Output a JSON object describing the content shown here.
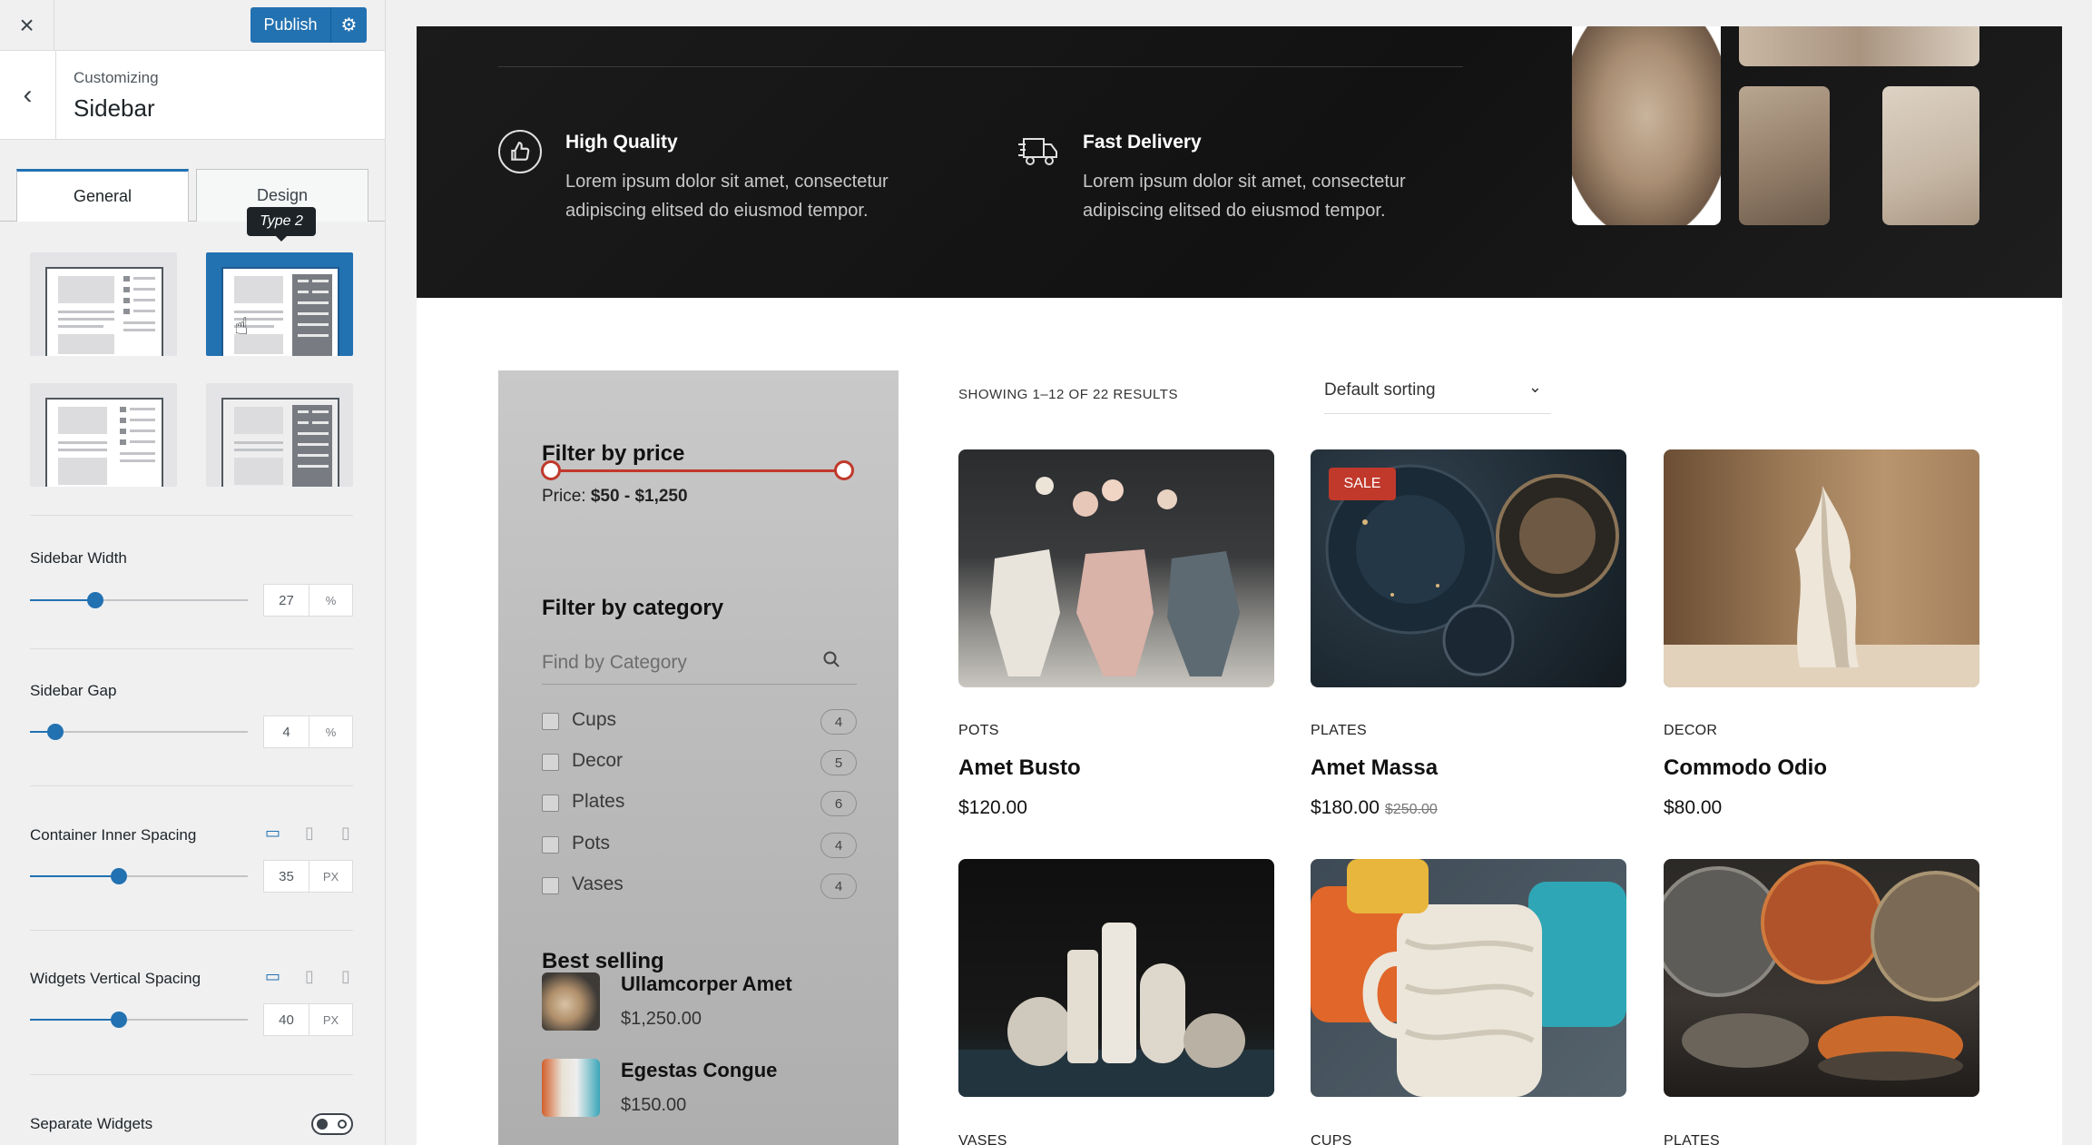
{
  "customizer": {
    "close_icon": "×",
    "publish_label": "Publish",
    "gear_icon": "⚙",
    "back_icon": "‹",
    "subtitle": "Customizing",
    "title": "Sidebar",
    "tabs": [
      {
        "label": "General"
      },
      {
        "label": "Design"
      }
    ],
    "tooltip": "Type 2",
    "layout_options": [
      "type-1",
      "type-2",
      "type-3",
      "type-4"
    ],
    "selected_layout": "type-2",
    "settings": {
      "sidebar_width": {
        "label": "Sidebar Width",
        "value": "27",
        "unit": "%",
        "fraction": 0.27
      },
      "sidebar_gap": {
        "label": "Sidebar Gap",
        "value": "4",
        "unit": "%",
        "fraction": 0.04
      },
      "container_inner_spacing": {
        "label": "Container Inner Spacing",
        "value": "35",
        "unit": "PX",
        "fraction": 0.35
      },
      "widgets_vertical_spacing": {
        "label": "Widgets Vertical Spacing",
        "value": "40",
        "unit": "PX",
        "fraction": 0.35
      },
      "separate_widgets": {
        "label": "Separate Widgets",
        "enabled": false
      }
    }
  },
  "preview": {
    "features": [
      {
        "icon": "thumbs-up-icon",
        "title": "High Quality",
        "text": "Lorem ipsum dolor sit amet, consectetur adipiscing elitsed do eiusmod tempor."
      },
      {
        "icon": "delivery-truck-icon",
        "title": "Fast Delivery",
        "text": "Lorem ipsum dolor sit amet, consectetur adipiscing elitsed do eiusmod tempor."
      }
    ],
    "sidebar": {
      "filter_price_title": "Filter by price",
      "price_prefix": "Price:",
      "price_range": "$50 - $1,250",
      "filter_category_title": "Filter by category",
      "category_placeholder": "Find by Category",
      "categories": [
        {
          "name": "Cups",
          "count": "4"
        },
        {
          "name": "Decor",
          "count": "5"
        },
        {
          "name": "Plates",
          "count": "6"
        },
        {
          "name": "Pots",
          "count": "4"
        },
        {
          "name": "Vases",
          "count": "4"
        }
      ],
      "best_selling_title": "Best selling",
      "best_selling": [
        {
          "name": "Ullamcorper Amet",
          "price": "$1,250.00"
        },
        {
          "name": "Egestas Congue",
          "price": "$150.00"
        }
      ]
    },
    "results_text": "SHOWING 1–12 OF 22 RESULTS",
    "sorting_label": "Default sorting",
    "products": [
      {
        "category": "POTS",
        "name": "Amet Busto",
        "price": "$120.00",
        "old_price": ""
      },
      {
        "category": "PLATES",
        "name": "Amet Massa",
        "price": "$180.00",
        "old_price": "$250.00",
        "badge": "SALE"
      },
      {
        "category": "DECOR",
        "name": "Commodo Odio",
        "price": "$80.00",
        "old_price": ""
      },
      {
        "category": "VASES",
        "name": "",
        "price": "",
        "old_price": ""
      },
      {
        "category": "CUPS",
        "name": "",
        "price": "",
        "old_price": ""
      },
      {
        "category": "PLATES",
        "name": "",
        "price": "",
        "old_price": ""
      }
    ]
  },
  "colors": {
    "accent": "#2271b1",
    "sale": "#c0392b",
    "hero_bg": "#141414"
  }
}
